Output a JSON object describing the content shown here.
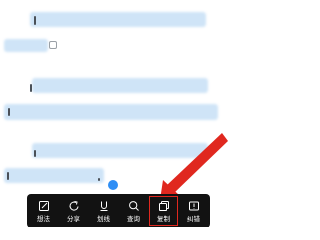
{
  "toolbar": {
    "items": [
      {
        "id": "note",
        "label": "想法",
        "icon": "note-edit-icon"
      },
      {
        "id": "share",
        "label": "分享",
        "icon": "share-icon"
      },
      {
        "id": "underline",
        "label": "划线",
        "icon": "underline-icon"
      },
      {
        "id": "lookup",
        "label": "查询",
        "icon": "search-icon"
      },
      {
        "id": "copy",
        "label": "复制",
        "icon": "copy-icon"
      },
      {
        "id": "report",
        "label": "纠错",
        "icon": "error-report-icon"
      }
    ],
    "highlighted_item": "copy"
  },
  "colors": {
    "selection_highlight": "#cfe4f7",
    "menu_background": "#121212",
    "annotation_red": "#e0281f",
    "caret_blue": "#2e8ef5"
  }
}
